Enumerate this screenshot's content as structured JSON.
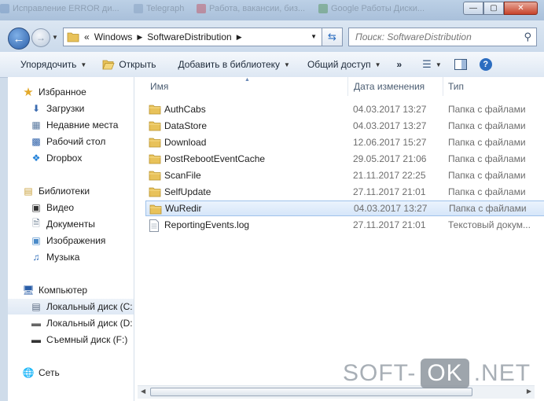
{
  "window": {
    "background_tabs": [
      "Исправление ERROR ди...",
      "Telegraph",
      "Работа, вакансии, биз...",
      "Google Работы Диски..."
    ],
    "controls": {
      "minimize": "—",
      "maximize": "▢",
      "close": "✕"
    }
  },
  "address_bar": {
    "overflow": "«",
    "path": [
      "Windows",
      "SoftwareDistribution"
    ]
  },
  "search": {
    "placeholder": "Поиск: SoftwareDistribution"
  },
  "toolbar": {
    "organize": "Упорядочить",
    "open": "Открыть",
    "add_to_library": "Добавить в библиотеку",
    "share": "Общий доступ",
    "more": "»"
  },
  "navpane": {
    "favorites": {
      "header": "Избранное",
      "items": [
        "Загрузки",
        "Недавние места",
        "Рабочий стол",
        "Dropbox"
      ]
    },
    "libraries": {
      "header": "Библиотеки",
      "items": [
        "Видео",
        "Документы",
        "Изображения",
        "Музыка"
      ]
    },
    "computer": {
      "header": "Компьютер",
      "items": [
        "Локальный диск (C:",
        "Локальный диск (D:",
        "Съемный диск (F:)"
      ]
    },
    "network": {
      "header": "Сеть"
    }
  },
  "columns": {
    "name": "Имя",
    "date": "Дата изменения",
    "type": "Тип"
  },
  "files": [
    {
      "name": "AuthCabs",
      "date": "04.03.2017 13:27",
      "type": "Папка с файлами",
      "kind": "folder"
    },
    {
      "name": "DataStore",
      "date": "04.03.2017 13:27",
      "type": "Папка с файлами",
      "kind": "folder"
    },
    {
      "name": "Download",
      "date": "12.06.2017 15:27",
      "type": "Папка с файлами",
      "kind": "folder"
    },
    {
      "name": "PostRebootEventCache",
      "date": "29.05.2017 21:06",
      "type": "Папка с файлами",
      "kind": "folder"
    },
    {
      "name": "ScanFile",
      "date": "21.11.2017 22:25",
      "type": "Папка с файлами",
      "kind": "folder"
    },
    {
      "name": "SelfUpdate",
      "date": "27.11.2017 21:01",
      "type": "Папка с файлами",
      "kind": "folder"
    },
    {
      "name": "WuRedir",
      "date": "04.03.2017 13:27",
      "type": "Папка с файлами",
      "kind": "folder",
      "selected": true
    },
    {
      "name": "ReportingEvents.log",
      "date": "27.11.2017 21:01",
      "type": "Текстовый докум...",
      "kind": "file"
    }
  ],
  "watermark": {
    "left": "SOFT-",
    "middle": "OK",
    "right": ".NET"
  },
  "colors": {
    "accent": "#2c5fa8",
    "folder": "#e8c25a",
    "selection": "#d6e6f9"
  }
}
